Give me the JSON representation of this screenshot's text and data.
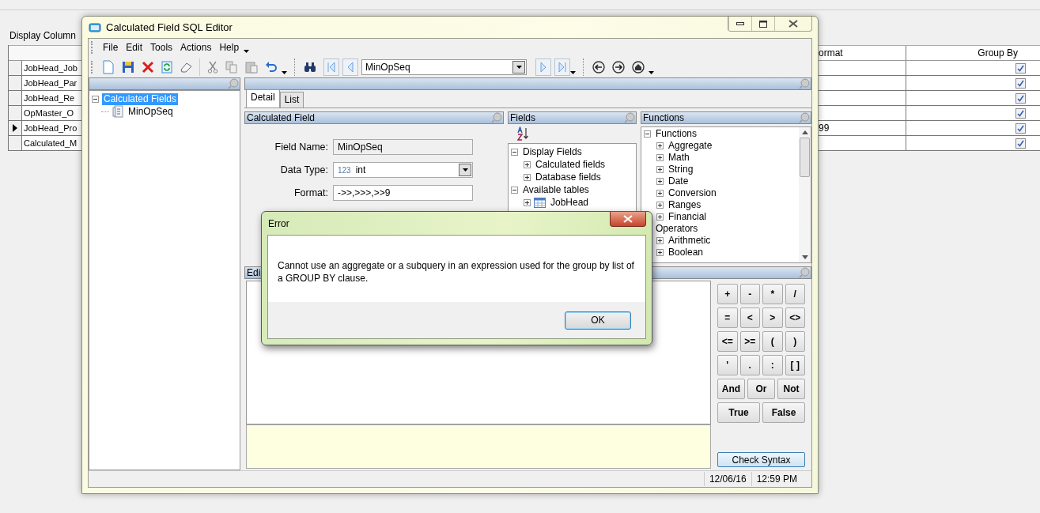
{
  "background_app": {
    "label": "Display Column",
    "grid": {
      "format_header": "ormat",
      "group_by_header": "Group By",
      "rows": [
        {
          "column_1": "JobHead_Job",
          "format": "",
          "group_by": true,
          "current": false
        },
        {
          "column_1": "JobHead_Par",
          "format": "",
          "group_by": true,
          "current": false
        },
        {
          "column_1": "JobHead_Re",
          "format": "",
          "group_by": true,
          "current": false
        },
        {
          "column_1": "OpMaster_O",
          "format": "",
          "group_by": true,
          "current": false
        },
        {
          "column_1": "JobHead_Pro",
          "format": "99",
          "group_by": true,
          "current": true
        },
        {
          "column_1": "Calculated_M",
          "format": "",
          "group_by": true,
          "current": false
        }
      ]
    }
  },
  "window": {
    "title": "Calculated Field SQL Editor",
    "menu": [
      "File",
      "Edit",
      "Tools",
      "Actions",
      "Help"
    ],
    "record_selector": {
      "value": "MinOpSeq"
    },
    "left_tree": [
      {
        "label": "Calculated Fields",
        "expanded": true,
        "selected": true,
        "children": [
          {
            "label": "MinOpSeq",
            "kind": "field",
            "selected": false
          }
        ]
      }
    ],
    "tabs": [
      {
        "label": "Detail",
        "selected": true
      },
      {
        "label": "List",
        "selected": false
      }
    ],
    "calculated_field": {
      "title": "Calculated Field",
      "fields": [
        {
          "label": "Field Name:",
          "value": "MinOpSeq",
          "kind": "readonly"
        },
        {
          "label": "Data Type:",
          "prefix": "123",
          "value": "int",
          "kind": "dropdown"
        },
        {
          "label": "Format:",
          "value": "->>,>>>,>>9",
          "kind": "text"
        }
      ]
    },
    "fields_pane": {
      "title": "Fields",
      "tree": [
        {
          "label": "Display Fields",
          "expanded": true,
          "children": [
            {
              "label": "Calculated fields",
              "expanded": false
            },
            {
              "label": "Database fields",
              "expanded": false
            }
          ]
        },
        {
          "label": "Available tables",
          "expanded": true,
          "children": [
            {
              "label": "JobHead",
              "expanded": false,
              "kind": "table"
            }
          ]
        }
      ]
    },
    "functions_pane": {
      "title": "Functions",
      "tree": [
        {
          "label": "Functions",
          "expanded": true,
          "children": [
            {
              "label": "Aggregate",
              "expanded": false
            },
            {
              "label": "Math",
              "expanded": false
            },
            {
              "label": "String",
              "expanded": false
            },
            {
              "label": "Date",
              "expanded": false
            },
            {
              "label": "Conversion",
              "expanded": false
            },
            {
              "label": "Ranges",
              "expanded": false
            },
            {
              "label": "Financial",
              "expanded": false
            }
          ]
        },
        {
          "label": "Operators",
          "expanded": true,
          "children": [
            {
              "label": "Arithmetic",
              "expanded": false
            },
            {
              "label": "Boolean",
              "expanded": false
            }
          ]
        }
      ]
    },
    "editor_pane": {
      "title": "Edi",
      "operator_rows": [
        [
          "+",
          "-",
          "*",
          "/"
        ],
        [
          "=",
          "<",
          ">",
          "<>"
        ],
        [
          "<=",
          ">=",
          "(",
          ")"
        ],
        [
          "'",
          ".",
          ":",
          "[ ]"
        ],
        [
          "And",
          "Or",
          "Not"
        ],
        [
          "True",
          "False"
        ]
      ],
      "check_button": "Check Syntax"
    },
    "status_bar": [
      "12/06/16",
      "12:59 PM"
    ]
  },
  "dialog": {
    "title": "Error",
    "message": "Cannot use an aggregate or a subquery in an expression used for the group by list of a GROUP BY clause.",
    "button": "OK"
  }
}
